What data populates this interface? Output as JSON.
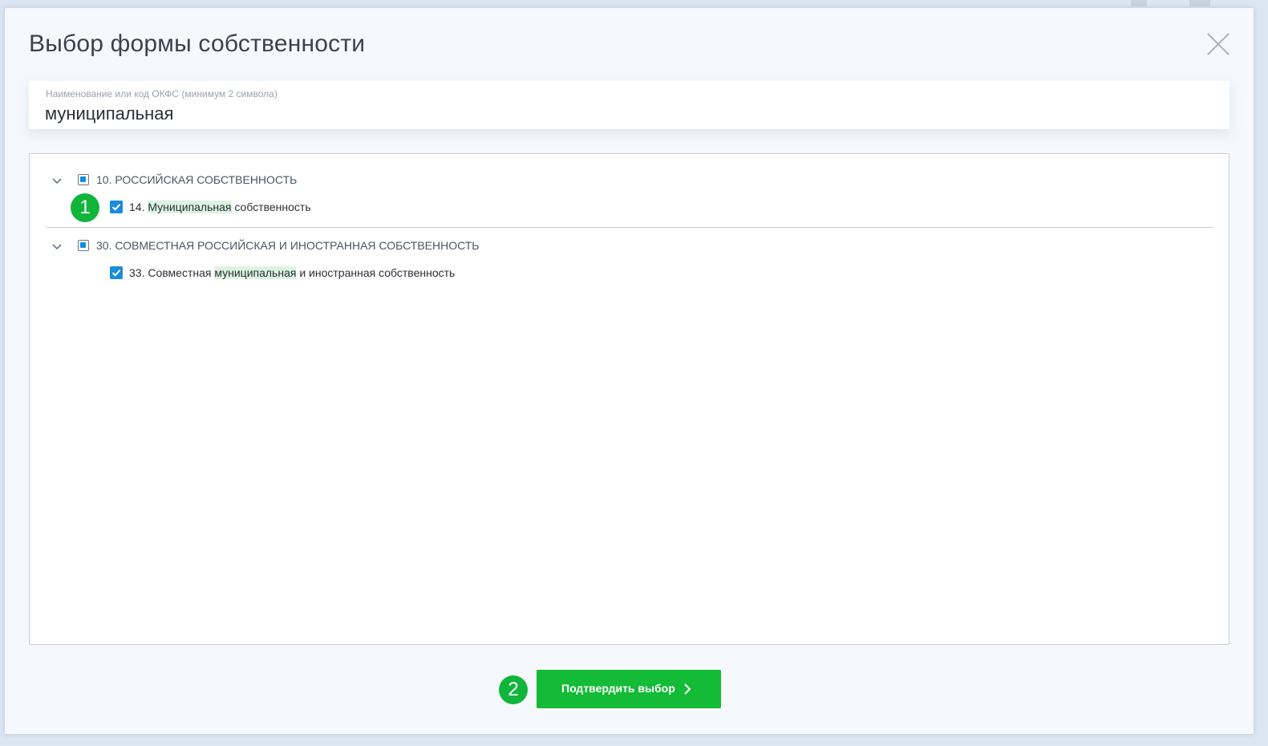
{
  "modal": {
    "title": "Выбор формы собственности",
    "close_icon": "close-icon"
  },
  "search": {
    "label": "Наименование или код ОКФС (минимум 2 символа)",
    "value": "муниципальная"
  },
  "tree": {
    "groups": [
      {
        "label": "10. РОССИЙСКАЯ СОБСТВЕННОСТЬ",
        "state": "partial",
        "children": [
          {
            "prefix": "14. ",
            "highlight": "Муниципальная",
            "suffix": " собственность",
            "checked": true
          }
        ]
      },
      {
        "label": "30. СОВМЕСТНАЯ РОССИЙСКАЯ И ИНОСТРАННАЯ СОБСТВЕННОСТЬ",
        "state": "partial",
        "children": [
          {
            "prefix": "33. Совместная ",
            "highlight": "муниципальная",
            "suffix": " и иностранная собственность",
            "checked": true
          }
        ]
      }
    ]
  },
  "markers": {
    "step1": "1",
    "step2": "2"
  },
  "footer": {
    "confirm_label": "Подтвердить выбор"
  },
  "colors": {
    "accent_green": "#13bb36",
    "checkbox_blue": "#1a8ce0",
    "highlight": "#dcf3e2"
  }
}
